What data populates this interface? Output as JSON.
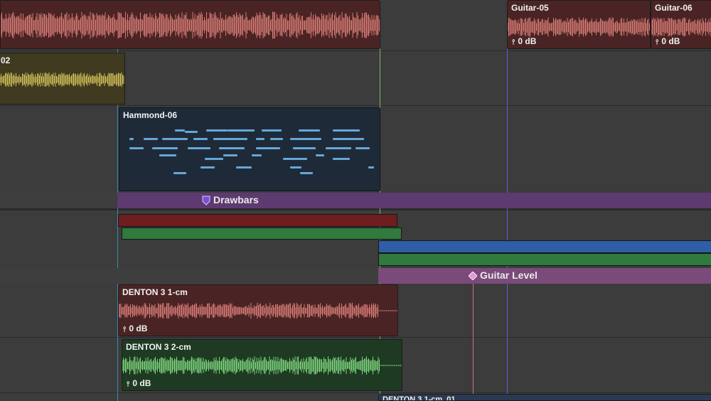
{
  "colors": {
    "background": "#3c3c3c",
    "audio_red": "#d77c76",
    "audio_red_bg": "#4a2424",
    "audio_yellow": "#d2c15a",
    "audio_yellow_bg": "#3f3a20",
    "midi_blue": "#64a7d8",
    "midi_bg": "#1f2a38",
    "audio_green": "#7fd87f",
    "audio_green_bg": "#1f3a22",
    "drawbars_purple": "#6a3e80",
    "guitar_level_pink": "#8f5a8a",
    "bar_red": "#6e1e1e",
    "bar_green": "#2f7a3c",
    "bar_blue": "#2f5da6",
    "playhead_green": "#8ab45a",
    "marker_purple": "#6a55d8",
    "marker_cyan": "#3a8aa8",
    "marker_pink": "#d06a9a"
  },
  "clips": {
    "guitar05": {
      "name": "Guitar-05",
      "gain": "0 dB"
    },
    "guitar06": {
      "name": "Guitar-06",
      "gain": "0 dB"
    },
    "yellow02": {
      "name": "02"
    },
    "hammond06": {
      "name": "Hammond-06"
    },
    "denton1": {
      "name": "DENTON 3 1-cm",
      "gain": "0 dB"
    },
    "denton2": {
      "name": "DENTON 3 2-cm",
      "gain": "0 dB"
    },
    "denton1b": {
      "name": "DENTON 3 1-cm_01"
    }
  },
  "automation": {
    "drawbars": {
      "label": "Drawbars",
      "icon": "shield-marker-icon"
    },
    "guitar_level": {
      "label": "Guitar Level",
      "icon": "diamond-marker-icon"
    }
  },
  "icons": {
    "gain": "tuning-fork-icon"
  }
}
